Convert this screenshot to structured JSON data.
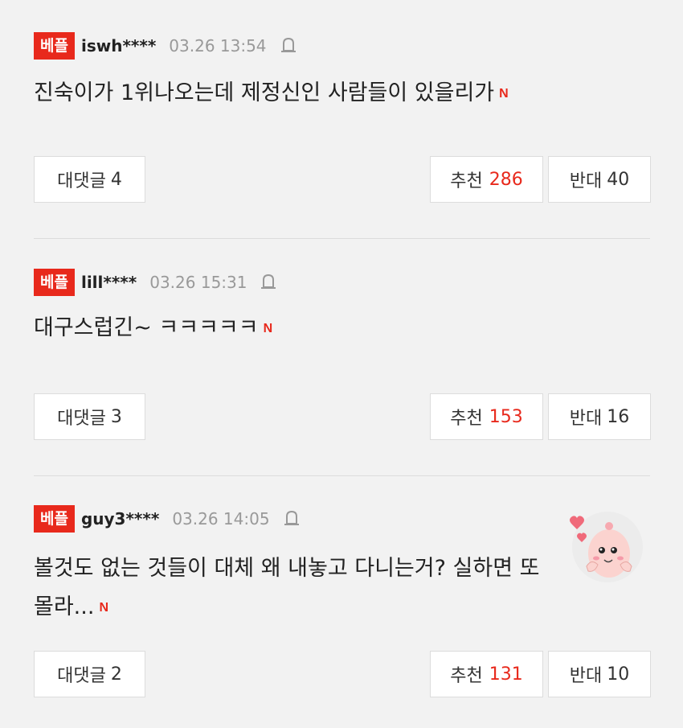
{
  "comments": [
    {
      "badge": "베플",
      "user": "iswh****",
      "time": "03.26 13:54",
      "text": "진숙이가 1위나오는데 제정신인 사람들이 있을리가",
      "new_mark": "N",
      "reply_label": "대댓글",
      "reply_count": "4",
      "like_label": "추천",
      "like_count": "286",
      "dislike_label": "반대",
      "dislike_count": "40"
    },
    {
      "badge": "베플",
      "user": "lill****",
      "time": "03.26 15:31",
      "text": "대구스럽긴~ ㅋㅋㅋㅋㅋ",
      "new_mark": "N",
      "reply_label": "대댓글",
      "reply_count": "3",
      "like_label": "추천",
      "like_count": "153",
      "dislike_label": "반대",
      "dislike_count": "16"
    },
    {
      "badge": "베플",
      "user": "guy3****",
      "time": "03.26 14:05",
      "text": "볼것도 없는 것들이 대체 왜 내놓고 다니는거? 실하면 또 몰라...",
      "new_mark": "N",
      "reply_label": "대댓글",
      "reply_count": "2",
      "like_label": "추천",
      "like_count": "131",
      "dislike_label": "반대",
      "dislike_count": "10"
    }
  ],
  "colors": {
    "accent": "#e8291c",
    "background": "#f2f2f2",
    "muted": "#999999"
  },
  "icons": {
    "bell": "bell-icon",
    "sticker": "emoticon-sticker"
  }
}
